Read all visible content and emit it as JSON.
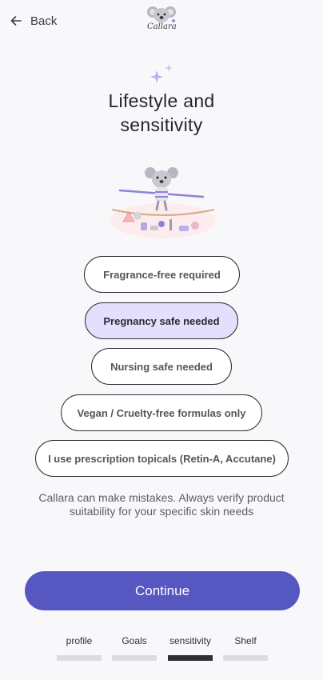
{
  "header": {
    "back_label": "Back",
    "logo_text": "Callara",
    "logo_icon": "koala-logo-icon"
  },
  "title": {
    "line1": "Lifestyle and",
    "line2": "sensitivity"
  },
  "hero": {
    "icon": "koala-tightrope-illustration"
  },
  "options": [
    {
      "label": "Fragrance-free required",
      "selected": false
    },
    {
      "label": "Pregnancy safe needed",
      "selected": true
    },
    {
      "label": "Nursing safe needed",
      "selected": false
    },
    {
      "label": "Vegan / Cruelty-free formulas only",
      "selected": false
    },
    {
      "label": "I use prescription topicals (Retin-A, Accutane)",
      "selected": false
    }
  ],
  "disclaimer": "Callara can make mistakes. Always verify product suitability for your specific skin needs",
  "continue_label": "Continue",
  "steps": [
    {
      "label": "profile",
      "active": false
    },
    {
      "label": "Goals",
      "active": false
    },
    {
      "label": "sensitivity",
      "active": true
    },
    {
      "label": "Shelf",
      "active": false
    }
  ],
  "colors": {
    "accent": "#5757c1",
    "selected_bg": "#e3dffd",
    "sparkle": "#b9aef0",
    "background": "#f8f8fa"
  }
}
